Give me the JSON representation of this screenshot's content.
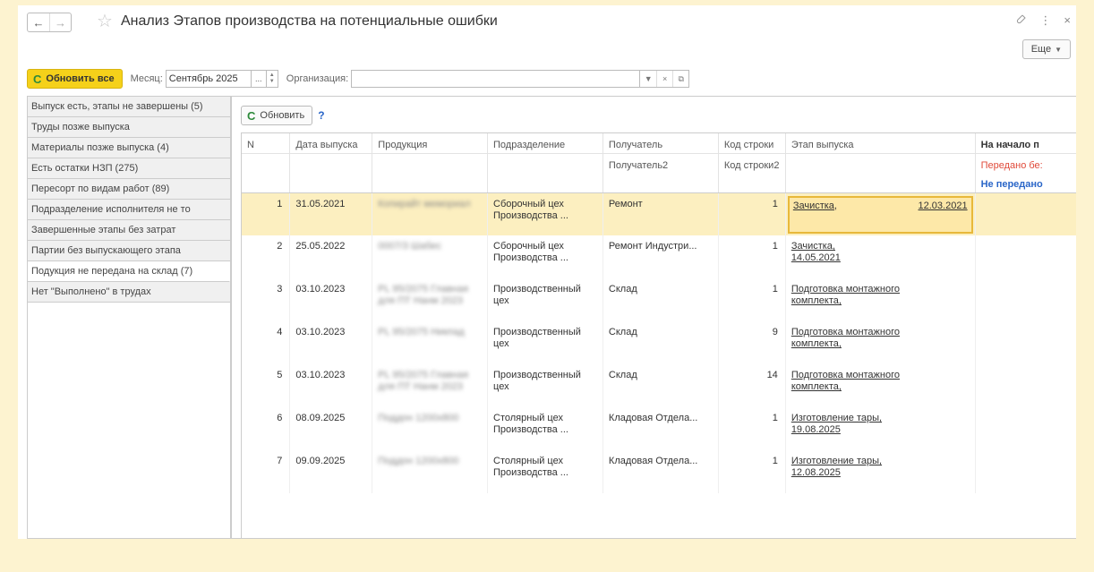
{
  "window": {
    "title": "Анализ Этапов производства на потенциальные ошибки",
    "more_label": "Еще",
    "nav_back": "←",
    "nav_forward": "→",
    "star": "☆",
    "link_icon": "🔗",
    "menu_icon": "⋮",
    "close_icon": "×"
  },
  "toolbar": {
    "refresh_all_label": "Обновить все",
    "month_label": "Месяц:",
    "month_value": "Сентябрь 2025",
    "org_label": "Организация:",
    "org_value": ""
  },
  "left_tabs": [
    {
      "label": "Выпуск есть, этапы не завершены (5)"
    },
    {
      "label": "Труды позже выпуска"
    },
    {
      "label": "Материалы позже выпуска (4)"
    },
    {
      "label": "Есть остатки НЗП (275)"
    },
    {
      "label": "Пересорт по видам работ (89)"
    },
    {
      "label": "Подразделение исполнителя не то"
    },
    {
      "label": "Завершенные этапы без затрат"
    },
    {
      "label": "Партии без выпускающего этапа"
    },
    {
      "label": "Подукция не передана на склад (7)"
    },
    {
      "label": "Нет \"Выполнено\" в трудах"
    }
  ],
  "main": {
    "refresh_label": "Обновить",
    "help_label": "?",
    "columns": {
      "n": "N",
      "date": "Дата выпуска",
      "product": "Продукция",
      "division": "Подразделение",
      "recipient": "Получатель",
      "recipient2": "Получатель2",
      "code": "Код строки",
      "code2": "Код строки2",
      "stage": "Этап выпуска",
      "start": "На начало п",
      "start_red": "Передано бе:",
      "start_blue": "Не передано"
    },
    "rows": [
      {
        "n": "1",
        "date": "31.05.2021",
        "product": "Копирайт мемориал",
        "division": "Сборочный цех Производства ...",
        "recipient": "Ремонт",
        "code": "1",
        "stage": "Зачистка,",
        "stage_date": "12.03.2021"
      },
      {
        "n": "2",
        "date": "25.05.2022",
        "product": "0007/3 Шабес",
        "division": "Сборочный цех Производства ...",
        "recipient": "Ремонт Индустри...",
        "code": "1",
        "stage": "Зачистка, 14.05.2021",
        "stage_date": ""
      },
      {
        "n": "3",
        "date": "03.10.2023",
        "product": "PL 95/2075 Главная для ПТ Нанм 2023",
        "division": "Производственный цех",
        "recipient": "Склад",
        "code": "1",
        "stage": "Подготовка монтажного комплекта,",
        "stage_date": ""
      },
      {
        "n": "4",
        "date": "03.10.2023",
        "product": "PL 95/2075 Никпад",
        "division": "Производственный цех",
        "recipient": "Склад",
        "code": "9",
        "stage": "Подготовка монтажного комплекта,",
        "stage_date": ""
      },
      {
        "n": "5",
        "date": "03.10.2023",
        "product": "PL 95/2075 Главная для ПТ Нанм 2023",
        "division": "Производственный цех",
        "recipient": "Склад",
        "code": "14",
        "stage": "Подготовка монтажного комплекта,",
        "stage_date": ""
      },
      {
        "n": "6",
        "date": "08.09.2025",
        "product": "Поддон 1200х800",
        "division": "Столярный цех Производства ...",
        "recipient": "Кладовая Отдела...",
        "code": "1",
        "stage": "Изготовление тары, 19.08.2025",
        "stage_date": ""
      },
      {
        "n": "7",
        "date": "09.09.2025",
        "product": "Поддон 1200х800",
        "division": "Столярный цех Производства ...",
        "recipient": "Кладовая Отдела...",
        "code": "1",
        "stage": "Изготовление тары, 12.08.2025",
        "stage_date": ""
      }
    ]
  },
  "colors": {
    "accent": "#f5d11a",
    "selection": "#fcefc0",
    "red": "#e04a3a",
    "blue": "#2a66c8",
    "page_bg": "#fdf3d0"
  }
}
